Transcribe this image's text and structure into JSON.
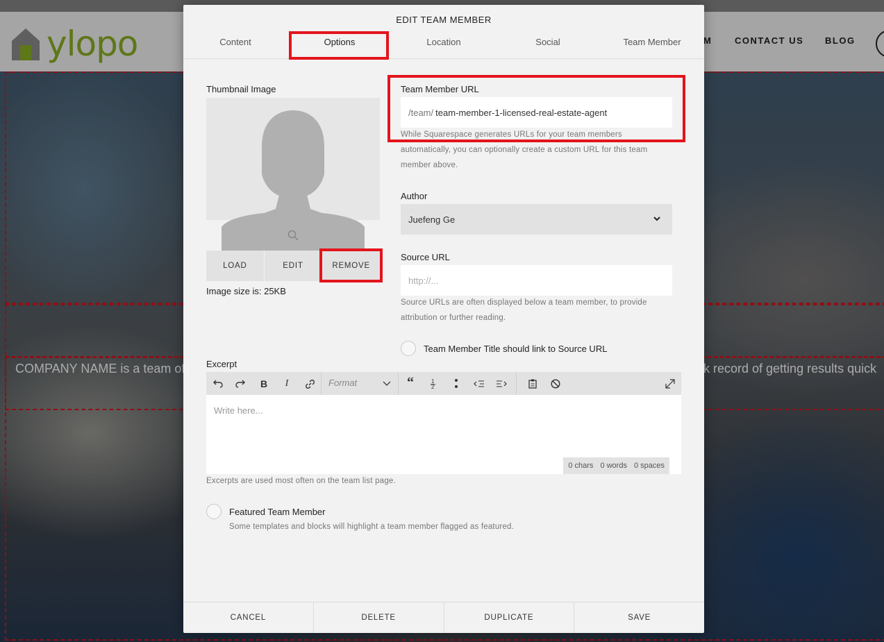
{
  "site": {
    "logo_text": "ylopo",
    "nav": [
      "M",
      "CONTACT US",
      "BLOG"
    ],
    "hero_text_left": "COMPANY NAME is a team of",
    "hero_text_right": "k record of getting results quick"
  },
  "modal": {
    "title": "EDIT TEAM MEMBER",
    "tabs": [
      "Content",
      "Options",
      "Location",
      "Social",
      "Team Member"
    ],
    "active_tab": "Options",
    "thumbnail": {
      "label": "Thumbnail Image",
      "buttons": {
        "load": "LOAD",
        "edit": "EDIT",
        "remove": "REMOVE"
      },
      "size_text": "Image size is: 25KB"
    },
    "url": {
      "label": "Team Member URL",
      "prefix": "/team/",
      "value": "team-member-1-licensed-real-estate-agent",
      "help_lines": [
        "While Squarespace generates URLs for your team members",
        "automatically, you can optionally create a custom URL for this team",
        "member above."
      ]
    },
    "author": {
      "label": "Author",
      "value": "Juefeng Ge"
    },
    "source": {
      "label": "Source URL",
      "placeholder": "http://...",
      "help_lines": [
        "Source URLs are often displayed below a team member, to provide",
        "attribution or further reading."
      ],
      "link_label": "Team Member Title should link to Source URL"
    },
    "excerpt": {
      "label": "Excerpt",
      "format_label": "Format",
      "placeholder": "Write here...",
      "counter": {
        "chars": "0 chars",
        "words": "0 words",
        "spaces": "0 spaces"
      },
      "help": "Excerpts are used most often on the team list page."
    },
    "featured": {
      "label": "Featured Team Member",
      "help": "Some templates and blocks will highlight a team member flagged as featured."
    },
    "footer": {
      "cancel": "CANCEL",
      "delete": "DELETE",
      "duplicate": "DUPLICATE",
      "save": "SAVE"
    }
  },
  "colors": {
    "accent_red": "#e4141d",
    "logo_green": "#8bb026",
    "dash_red": "#c0141d"
  }
}
